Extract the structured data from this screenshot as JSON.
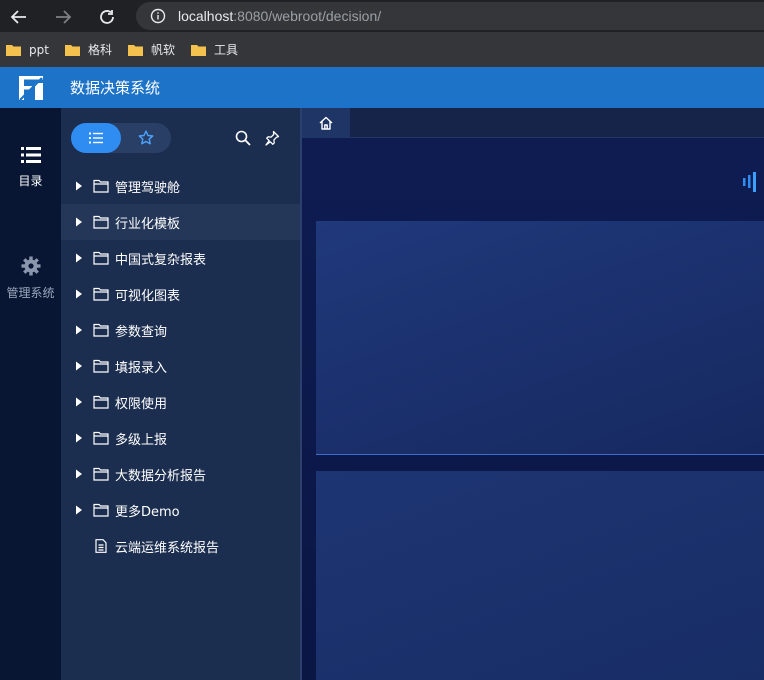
{
  "browser": {
    "url_host": "localhost",
    "url_path": ":8080/webroot/decision/",
    "bookmarks": [
      {
        "label": "ppt"
      },
      {
        "label": "格科"
      },
      {
        "label": "帆软"
      },
      {
        "label": "工具"
      }
    ]
  },
  "app": {
    "title": "数据决策系统"
  },
  "rail": {
    "items": [
      {
        "label": "目录",
        "icon": "list-icon"
      },
      {
        "label": "管理系统",
        "icon": "gear-icon"
      }
    ]
  },
  "directory": {
    "items": [
      {
        "label": "管理驾驶舱",
        "type": "folder"
      },
      {
        "label": "行业化模板",
        "type": "folder"
      },
      {
        "label": "中国式复杂报表",
        "type": "folder"
      },
      {
        "label": "可视化图表",
        "type": "folder"
      },
      {
        "label": "参数查询",
        "type": "folder"
      },
      {
        "label": "填报录入",
        "type": "folder"
      },
      {
        "label": "权限使用",
        "type": "folder"
      },
      {
        "label": "多级上报",
        "type": "folder"
      },
      {
        "label": "大数据分析报告",
        "type": "folder"
      },
      {
        "label": "更多Demo",
        "type": "folder"
      },
      {
        "label": "云端运维系统报告",
        "type": "file"
      }
    ]
  },
  "colors": {
    "header": "#1d73c8",
    "accent": "#2f8cf0",
    "rail_bg": "#081634",
    "panel_bg": "#1c2e50"
  }
}
